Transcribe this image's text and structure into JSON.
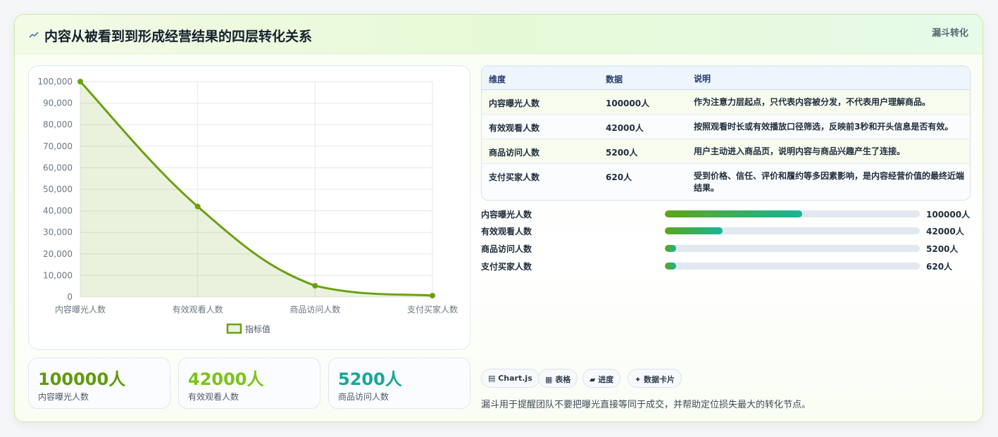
{
  "header": {
    "title": "内容从被看到到形成经营结果的四层转化关系",
    "badge": "漏斗转化"
  },
  "chart_data": {
    "type": "area",
    "categories": [
      "内容曝光人数",
      "有效观看人数",
      "商品访问人数",
      "支付买家人数"
    ],
    "series": [
      {
        "name": "指标值",
        "values": [
          100000,
          42000,
          5200,
          620
        ]
      }
    ],
    "ylim": [
      0,
      100000
    ],
    "yticks": [
      "100,000",
      "90,000",
      "80,000",
      "70,000",
      "60,000",
      "50,000",
      "40,000",
      "30,000",
      "20,000",
      "10,000",
      "0"
    ],
    "legend": "bottom",
    "grid": true,
    "color": "#6aa10f"
  },
  "table": {
    "headers": [
      "维度",
      "数据",
      "说明"
    ],
    "rows": [
      [
        "内容曝光人数",
        "100000人",
        "作为注意力层起点，只代表内容被分发，不代表用户理解商品。"
      ],
      [
        "有效观看人数",
        "42000人",
        "按照观看时长或有效播放口径筛选，反映前3秒和开头信息是否有效。"
      ],
      [
        "商品访问人数",
        "5200人",
        "用户主动进入商品页，说明内容与商品兴趣产生了连接。"
      ],
      [
        "支付买家人数",
        "620人",
        "受到价格、信任、评价和履约等多因素影响，是内容经营价值的最终近端结果。"
      ]
    ]
  },
  "progress": [
    {
      "label": "内容曝光人数",
      "value": "100000人",
      "fraction": 0.54
    },
    {
      "label": "有效观看人数",
      "value": "42000人",
      "fraction": 0.226
    },
    {
      "label": "商品访问人数",
      "value": "5200人",
      "fraction": 0.044
    },
    {
      "label": "支付买家人数",
      "value": "620人",
      "fraction": 0.044
    }
  ],
  "stats": [
    {
      "value": "100000人",
      "label": "内容曝光人数",
      "color": "#5e9c0c"
    },
    {
      "value": "42000人",
      "label": "有效观看人数",
      "color": "#7cc319"
    },
    {
      "value": "5200人",
      "label": "商品访问人数",
      "color": "#17a79a"
    }
  ],
  "chips": [
    "Chart.js",
    "表格",
    "进度",
    "数据卡片"
  ],
  "chip_icons": [
    "chart-icon",
    "table-icon",
    "progress-icon",
    "card-icon"
  ],
  "note": "漏斗用于提醒团队不要把曝光直接等同于成交，并帮助定位损失最大的转化节点。"
}
